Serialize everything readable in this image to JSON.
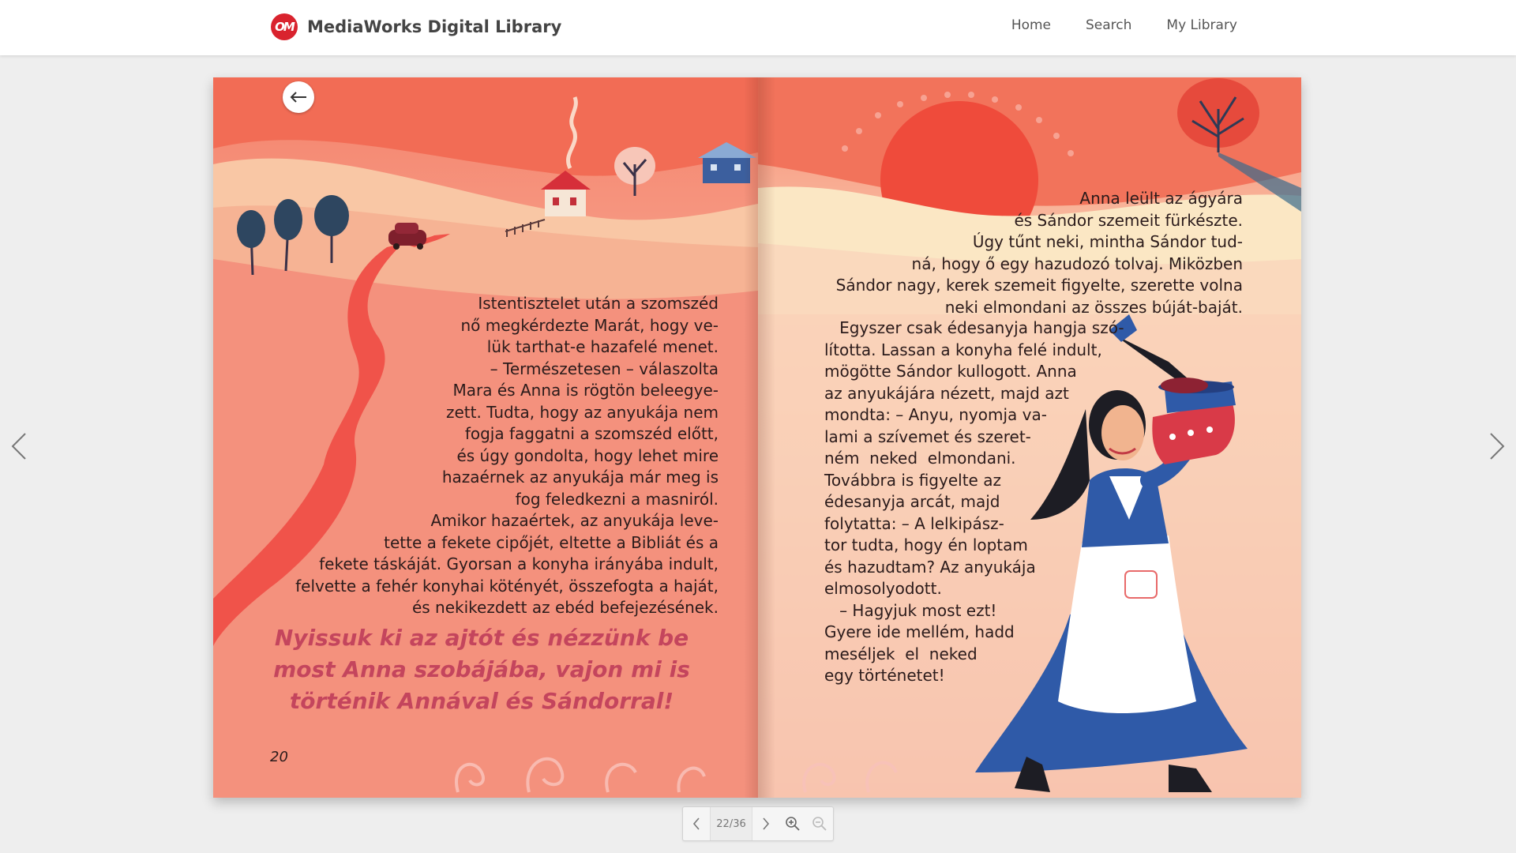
{
  "header": {
    "logo_text": "OM",
    "title": "MediaWorks Digital Library",
    "nav": [
      "Home",
      "Search",
      "My Library"
    ]
  },
  "book": {
    "left_page": {
      "text": "Istentisztelet után a szomszéd\nnő megkérdezte Marát, hogy ve-\nlük tarthat-e hazafelé menet.\n– Természetesen – válaszolta\nMara és Anna is rögtön beleegye-\nzett. Tudta, hogy az anyukája nem\nfogja faggatni a szomszéd előtt,\nés úgy gondolta, hogy lehet mire\nhazaérnek az anyukája már meg is\nfog feledkezni a masniról.\nAmikor hazaértek, az anyukája leve-\ntette a fekete cipőjét, eltette a Bibliát és a\nfekete táskáját. Gyorsan a konyha irányába indult,\nfelvette a fehér konyhai kötényét, összefogta a haját,\nés nekikezdett az ebéd befejezésének.",
      "emphasis": "Nyissuk ki az ajtót és nézzünk be\nmost Anna szobájába, vajon mi is\ntörténik Annával és Sándorral!",
      "page_number": "20"
    },
    "right_page": {
      "text_top": "Anna leült az ágyára\nés Sándor szemeit fürkészte.\nÚgy tűnt neki, mintha Sándor tud-\nná, hogy ő egy hazudozó tolvaj. Miközben\nSándor nagy, kerek szemeit figyelte, szerette volna\nneki elmondani az összes búját-baját.",
      "text_body": "   Egyszer csak édesanyja hangja szó-\nlította. Lassan a konyha felé indult,\nmögötte Sándor kullogott. Anna\naz anyukájára nézett, majd azt\nmondta: – Anyu, nyomja va-\nlami a szívemet és szeret-\nném  neked  elmondani.\nTovábbra is figyelte az\nédesanyja arcát, majd\nfolytatta: – A lelkipász-\ntor tudta, hogy én loptam\nés hazudtam? Az anyukája\nelmosolyodott.\n   – Hagyjuk most ezt!\nGyere ide mellém, hadd\nmeséljek  el  neked\negy történetet!"
    }
  },
  "toolbar": {
    "page_indicator": "22/36"
  },
  "colors": {
    "brand_red": "#d9232e",
    "emphasis_pink": "#c4455d",
    "road_red": "#f0534a",
    "dress_blue": "#2f5aa8"
  },
  "icons": [
    "back-arrow-icon",
    "chevron-left-icon",
    "chevron-right-icon",
    "zoom-in-icon",
    "zoom-out-icon"
  ]
}
